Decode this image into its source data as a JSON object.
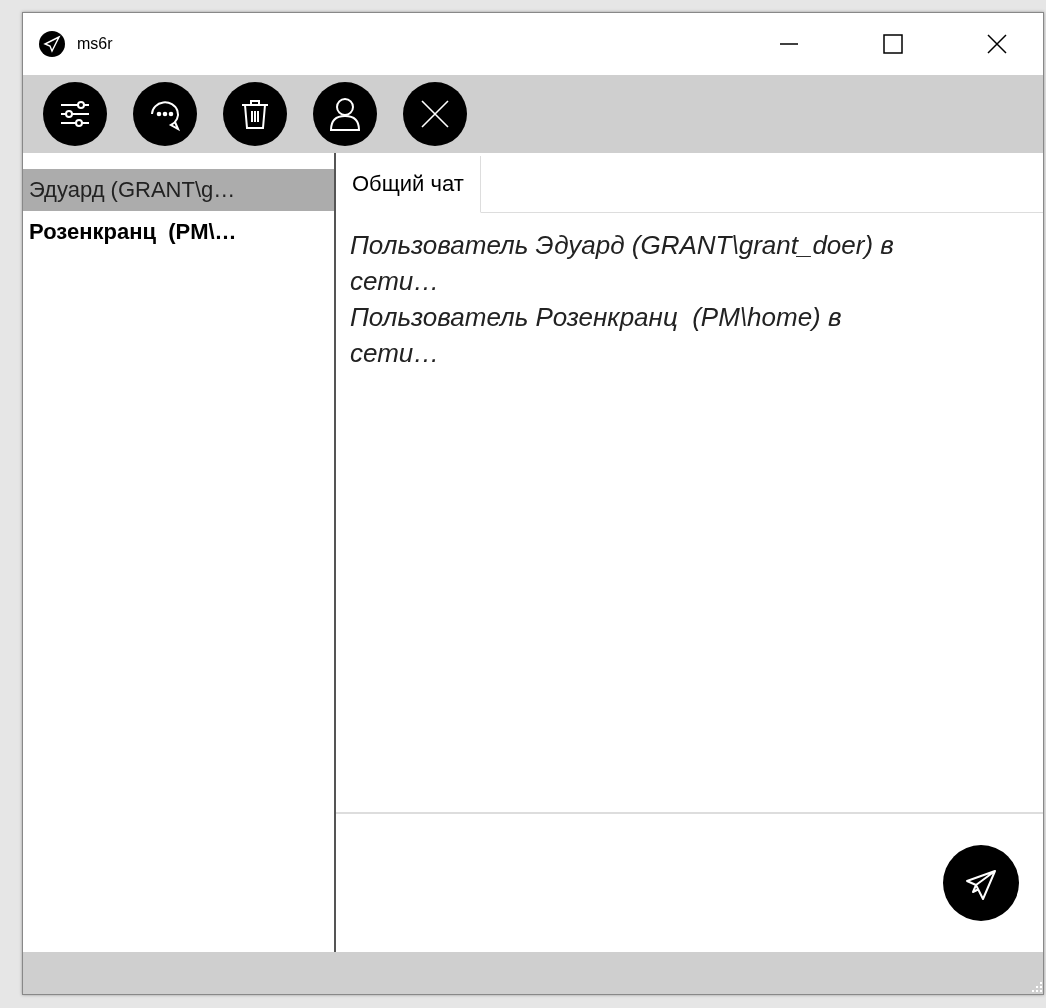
{
  "window": {
    "title": "ms6r"
  },
  "toolbar": [
    {
      "kind": "settings"
    },
    {
      "kind": "chat"
    },
    {
      "kind": "delete"
    },
    {
      "kind": "user"
    },
    {
      "kind": "close"
    }
  ],
  "users": [
    {
      "name": "Эдуард (GRANT\\g…",
      "selected": true,
      "unread": false
    },
    {
      "name": "Розенкранц  (PM\\…",
      "selected": false,
      "unread": true
    }
  ],
  "tabs": [
    {
      "label": "Общий чат",
      "selected": true
    }
  ],
  "messages": [
    "Пользователь Эдуард (GRANT\\grant_doer) в сети…",
    "Пользователь Розенкранц  (PM\\home) в сети…"
  ]
}
